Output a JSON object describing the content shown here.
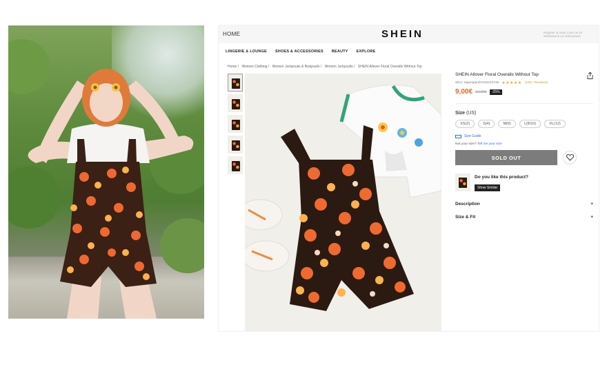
{
  "header": {
    "home": "HOME",
    "logo": "SHEIN",
    "sign_in": "Register & more 1.0% on Dr Weekend & no Instructions"
  },
  "nav": [
    "LINGERIE & LOUNGE",
    "SHOES & ACCESSORIES",
    "BEAUTY",
    "EXPLORE"
  ],
  "breadcrumb": [
    "Home /",
    "Women Clothing /",
    "Women Jumpsuits & Bodysuits /",
    "Women Jumpsuits /",
    "SHEIN Allover Floral Overalls Without Top"
  ],
  "product": {
    "title": "SHEIN Allover Floral Overalls Without Top",
    "sku": "SKU: swjumpsu07210414745",
    "stars": "★★★★★",
    "reviews": "(100+ Reviews)",
    "price": "9,00€",
    "old_price": "12,00€",
    "discount": "-25%"
  },
  "size": {
    "label": "Size",
    "unit": "(US)",
    "options": [
      "XS(2)",
      "S(4)",
      "M(6)",
      "L(8/10)",
      "XL(12)"
    ],
    "guide": "Size Guide",
    "not_sure": "Not your size?",
    "tell_me": "Tell me your size"
  },
  "actions": {
    "sold_out": "SOLD OUT"
  },
  "like": {
    "question": "Do you like this product?",
    "show_similar": "Show Similar"
  },
  "accordion": [
    {
      "label": "Description",
      "symbol": "+"
    },
    {
      "label": "Size & Fit",
      "symbol": "+"
    }
  ]
}
